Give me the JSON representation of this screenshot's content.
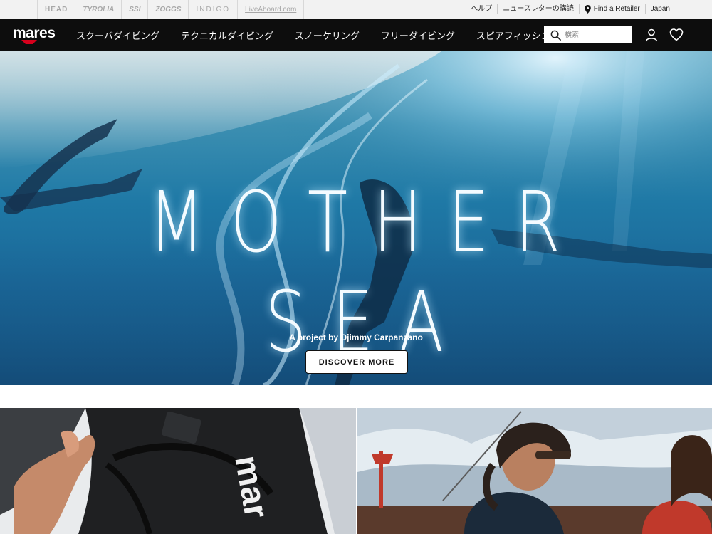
{
  "brands": [
    {
      "name": "head-logo",
      "label": "HEAD",
      "style": ""
    },
    {
      "name": "tyrolia-logo",
      "label": "TYROLIA",
      "style": "italic"
    },
    {
      "name": "ssi-logo",
      "label": "SSI",
      "style": "italic"
    },
    {
      "name": "zoggs-logo",
      "label": "ZOGGS",
      "style": "italic"
    },
    {
      "name": "indigo-logo",
      "label": "INDIGO",
      "style": "light"
    },
    {
      "name": "liveaboard-logo",
      "label": "LiveAboard.com",
      "style": "live"
    }
  ],
  "toplinks": {
    "help": "ヘルプ",
    "newsletter": "ニュースレターの購読",
    "find_retailer": "Find a Retailer",
    "country": "Japan"
  },
  "nav": {
    "logo": "mares",
    "menu": [
      "スクーバダイビング",
      "テクニカルダイビング",
      "スノーケリング",
      "フリーダイビング",
      "スピアフィッシン"
    ],
    "search_placeholder": "検索",
    "icons": [
      "search-icon",
      "user-icon",
      "heart-icon"
    ]
  },
  "hero": {
    "title": "MOTHER SEA",
    "subtitle": "A project by Djimmy Carpanzano",
    "button": "DISCOVER MORE"
  },
  "colors": {
    "nav_bg": "#0d0d0d",
    "topbar_bg": "#f2f2f2",
    "accent_red": "#d6001c",
    "hero_water": "#1f79a6"
  }
}
